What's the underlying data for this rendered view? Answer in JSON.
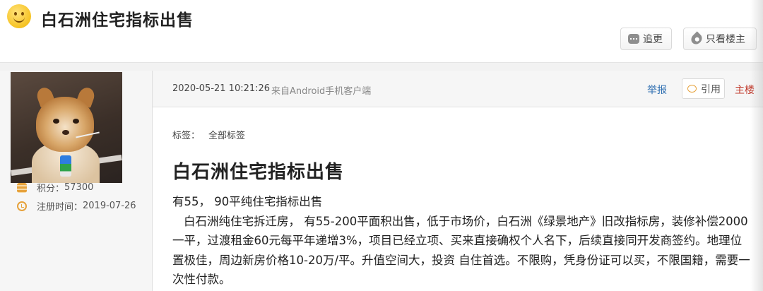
{
  "header": {
    "title": "白石洲住宅指标出售",
    "follow_label": "追更",
    "owner_only_label": "只看楼主"
  },
  "user": {
    "points_label": "积分：",
    "points_value": "57300",
    "registered_label": "注册时间：",
    "registered_value": "2019-07-26"
  },
  "post": {
    "time": "2020-05-21 10:21:26",
    "source": "来自Android手机客户端",
    "report_label": "举报",
    "quote_label": "引用",
    "floor_label": "主楼",
    "tags_label": "标签：",
    "tags_value": "全部标签",
    "title": "白石洲住宅指标出售",
    "body_line1": "有55， 90平纯住宅指标出售",
    "body_para": "白石洲纯住宅拆迁房， 有55-200平面积出售，低于市场价，白石洲《绿景地产》旧改指标房，装修补偿2000一平，过渡租金60元每平年递增3%，项目已经立项、买来直接确权个人名下，后续直接同开发商签约。地理位置极佳，周边新房价格10-20万/平。升值空间大，投资 自住首选。不限购，凭身份证可以买，不限国籍，需要一次性付款。"
  },
  "colors": {
    "link": "#2f6fb1",
    "floor": "#c0392b",
    "accent": "#e6a23c"
  },
  "icons": [
    "smiley-icon",
    "chat-icon",
    "drop-icon",
    "coins-icon",
    "clock-icon",
    "quote-icon"
  ]
}
